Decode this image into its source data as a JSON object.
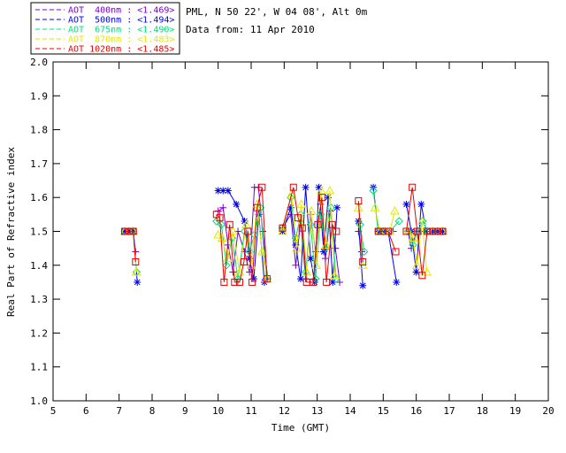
{
  "header": {
    "location_line": "PML, N 50 22', W 04 08', Alt 0m",
    "date_line": "Data from: 11 Apr 2010"
  },
  "chart_data": {
    "type": "line",
    "title": "",
    "xlabel": "Time (GMT)",
    "ylabel": "Real Part of Refractive index",
    "xlim": [
      5,
      20
    ],
    "ylim": [
      1.0,
      2.0
    ],
    "xticks": [
      "5",
      "6",
      "7",
      "8",
      "9",
      "10",
      "11",
      "12",
      "13",
      "14",
      "15",
      "16",
      "17",
      "18",
      "19",
      "20"
    ],
    "yticks": [
      "1.0",
      "1.1",
      "1.2",
      "1.3",
      "1.4",
      "1.5",
      "1.6",
      "1.7",
      "1.8",
      "1.9",
      "2.0"
    ],
    "grid": false,
    "legend_position": "top-left",
    "frame_color": "#000000",
    "series": [
      {
        "name": "AOT  400nm",
        "stat": "<1.469>",
        "color": "#7A00D0",
        "marker": "plus",
        "line_style": "solid",
        "segments": [
          [
            [
              7.17,
              1.5
            ],
            [
              7.3,
              1.5
            ],
            [
              7.43,
              1.5
            ],
            [
              7.5,
              1.44
            ]
          ],
          [
            [
              10.0,
              1.56
            ],
            [
              10.15,
              1.57
            ],
            [
              10.3,
              1.46
            ],
            [
              10.45,
              1.38
            ],
            [
              10.6,
              1.5
            ],
            [
              10.8,
              1.44
            ],
            [
              10.95,
              1.38
            ],
            [
              11.1,
              1.63
            ],
            [
              11.22,
              1.63
            ],
            [
              11.35,
              1.5
            ],
            [
              11.5,
              1.36
            ]
          ],
          [
            [
              11.95,
              1.51
            ],
            [
              12.2,
              1.55
            ],
            [
              12.35,
              1.4
            ],
            [
              12.5,
              1.53
            ],
            [
              12.65,
              1.36
            ],
            [
              12.8,
              1.55
            ],
            [
              12.95,
              1.44
            ],
            [
              13.1,
              1.58
            ],
            [
              13.25,
              1.42
            ],
            [
              13.4,
              1.56
            ],
            [
              13.55,
              1.45
            ],
            [
              13.68,
              1.35
            ]
          ],
          [
            [
              14.25,
              1.5
            ],
            [
              14.35,
              1.44
            ]
          ],
          [
            [
              14.85,
              1.5
            ],
            [
              15.0,
              1.5
            ],
            [
              15.15,
              1.5
            ],
            [
              15.3,
              1.5
            ]
          ],
          [
            [
              15.75,
              1.5
            ],
            [
              15.85,
              1.45
            ],
            [
              16.0,
              1.5
            ],
            [
              16.15,
              1.5
            ],
            [
              16.3,
              1.5
            ]
          ],
          [
            [
              16.5,
              1.5
            ],
            [
              16.65,
              1.5
            ],
            [
              16.8,
              1.5
            ]
          ]
        ]
      },
      {
        "name": "AOT  500nm",
        "stat": "<1.494>",
        "color": "#0000F0",
        "marker": "asterisk",
        "line_style": "solid",
        "segments": [
          [
            [
              7.17,
              1.5
            ],
            [
              7.3,
              1.5
            ],
            [
              7.43,
              1.5
            ],
            [
              7.55,
              1.35
            ]
          ],
          [
            [
              10.0,
              1.62
            ],
            [
              10.15,
              1.62
            ],
            [
              10.3,
              1.62
            ],
            [
              10.55,
              1.58
            ],
            [
              10.8,
              1.53
            ],
            [
              10.95,
              1.42
            ],
            [
              11.08,
              1.36
            ],
            [
              11.23,
              1.55
            ],
            [
              11.4,
              1.35
            ]
          ],
          [
            [
              11.95,
              1.5
            ],
            [
              12.2,
              1.57
            ],
            [
              12.35,
              1.46
            ],
            [
              12.5,
              1.36
            ],
            [
              12.65,
              1.63
            ],
            [
              12.8,
              1.42
            ],
            [
              12.92,
              1.35
            ],
            [
              13.05,
              1.63
            ],
            [
              13.2,
              1.44
            ],
            [
              13.33,
              1.6
            ],
            [
              13.47,
              1.35
            ],
            [
              13.6,
              1.57
            ]
          ],
          [
            [
              14.25,
              1.53
            ],
            [
              14.38,
              1.34
            ]
          ],
          [
            [
              14.7,
              1.63
            ],
            [
              14.85,
              1.5
            ],
            [
              15.0,
              1.5
            ],
            [
              15.15,
              1.5
            ],
            [
              15.4,
              1.35
            ]
          ],
          [
            [
              15.7,
              1.58
            ],
            [
              15.85,
              1.5
            ],
            [
              16.0,
              1.38
            ],
            [
              16.15,
              1.58
            ],
            [
              16.3,
              1.5
            ]
          ],
          [
            [
              16.5,
              1.5
            ],
            [
              16.65,
              1.5
            ],
            [
              16.8,
              1.5
            ]
          ]
        ]
      },
      {
        "name": "AOT  675nm",
        "stat": "<1.490>",
        "color": "#00E07A",
        "marker": "diamond",
        "line_style": "solid",
        "segments": [
          [
            [
              7.17,
              1.5
            ],
            [
              7.3,
              1.5
            ],
            [
              7.43,
              1.5
            ],
            [
              7.53,
              1.38
            ]
          ],
          [
            [
              9.95,
              1.53
            ],
            [
              10.1,
              1.52
            ],
            [
              10.25,
              1.4
            ],
            [
              10.42,
              1.48
            ],
            [
              10.6,
              1.36
            ],
            [
              10.8,
              1.5
            ],
            [
              10.95,
              1.44
            ],
            [
              11.1,
              1.49
            ],
            [
              11.28,
              1.57
            ],
            [
              11.45,
              1.36
            ]
          ],
          [
            [
              11.95,
              1.51
            ],
            [
              12.2,
              1.6
            ],
            [
              12.35,
              1.48
            ],
            [
              12.5,
              1.55
            ],
            [
              12.65,
              1.38
            ],
            [
              12.8,
              1.52
            ],
            [
              12.95,
              1.36
            ],
            [
              13.1,
              1.55
            ],
            [
              13.25,
              1.45
            ],
            [
              13.42,
              1.57
            ],
            [
              13.57,
              1.36
            ]
          ],
          [
            [
              14.3,
              1.52
            ],
            [
              14.42,
              1.44
            ]
          ],
          [
            [
              14.7,
              1.62
            ],
            [
              14.85,
              1.5
            ],
            [
              15.0,
              1.5
            ],
            [
              15.2,
              1.5
            ],
            [
              15.48,
              1.53
            ]
          ],
          [
            [
              15.75,
              1.5
            ],
            [
              15.9,
              1.46
            ],
            [
              16.05,
              1.5
            ],
            [
              16.2,
              1.53
            ],
            [
              16.35,
              1.5
            ]
          ],
          [
            [
              16.5,
              1.5
            ],
            [
              16.65,
              1.5
            ],
            [
              16.8,
              1.5
            ]
          ]
        ]
      },
      {
        "name": "AOT  870nm",
        "stat": "<1.483>",
        "color": "#E6E600",
        "marker": "triangle",
        "line_style": "solid",
        "segments": [
          [
            [
              7.17,
              1.5
            ],
            [
              7.3,
              1.5
            ],
            [
              7.43,
              1.5
            ],
            [
              7.52,
              1.38
            ]
          ],
          [
            [
              10.0,
              1.49
            ],
            [
              10.12,
              1.48
            ],
            [
              10.28,
              1.42
            ],
            [
              10.45,
              1.5
            ],
            [
              10.65,
              1.38
            ],
            [
              10.85,
              1.52
            ],
            [
              11.0,
              1.4
            ],
            [
              11.18,
              1.58
            ],
            [
              11.33,
              1.44
            ],
            [
              11.48,
              1.36
            ]
          ],
          [
            [
              11.95,
              1.5
            ],
            [
              12.22,
              1.61
            ],
            [
              12.38,
              1.45
            ],
            [
              12.52,
              1.58
            ],
            [
              12.68,
              1.38
            ],
            [
              12.82,
              1.56
            ],
            [
              12.97,
              1.4
            ],
            [
              13.12,
              1.62
            ],
            [
              13.27,
              1.46
            ],
            [
              13.38,
              1.62
            ],
            [
              13.53,
              1.37
            ]
          ],
          [
            [
              14.25,
              1.57
            ],
            [
              14.38,
              1.4
            ]
          ],
          [
            [
              14.75,
              1.57
            ],
            [
              14.9,
              1.5
            ],
            [
              15.05,
              1.5
            ],
            [
              15.2,
              1.5
            ],
            [
              15.35,
              1.56
            ]
          ],
          [
            [
              15.75,
              1.5
            ],
            [
              15.9,
              1.48
            ],
            [
              16.02,
              1.4
            ],
            [
              16.18,
              1.53
            ],
            [
              16.32,
              1.38
            ]
          ],
          [
            [
              16.5,
              1.5
            ],
            [
              16.65,
              1.5
            ],
            [
              16.8,
              1.5
            ]
          ]
        ]
      },
      {
        "name": "AOT 1020nm",
        "stat": "<1.485>",
        "color": "#E80000",
        "marker": "square",
        "line_style": "solid",
        "segments": [
          [
            [
              7.17,
              1.5
            ],
            [
              7.3,
              1.5
            ],
            [
              7.43,
              1.5
            ],
            [
              7.5,
              1.41
            ]
          ],
          [
            [
              9.95,
              1.55
            ],
            [
              10.05,
              1.54
            ],
            [
              10.18,
              1.35
            ],
            [
              10.35,
              1.52
            ],
            [
              10.5,
              1.35
            ],
            [
              10.65,
              1.35
            ],
            [
              10.78,
              1.41
            ],
            [
              10.9,
              1.5
            ],
            [
              11.03,
              1.35
            ],
            [
              11.18,
              1.57
            ],
            [
              11.33,
              1.63
            ],
            [
              11.48,
              1.36
            ]
          ],
          [
            [
              11.95,
              1.51
            ],
            [
              12.28,
              1.63
            ],
            [
              12.42,
              1.54
            ],
            [
              12.55,
              1.51
            ],
            [
              12.68,
              1.35
            ],
            [
              12.88,
              1.35
            ],
            [
              13.02,
              1.52
            ],
            [
              13.14,
              1.6
            ],
            [
              13.28,
              1.35
            ],
            [
              13.45,
              1.52
            ],
            [
              13.58,
              1.5
            ]
          ],
          [
            [
              14.25,
              1.59
            ],
            [
              14.38,
              1.41
            ]
          ],
          [
            [
              14.85,
              1.5
            ],
            [
              15.0,
              1.5
            ],
            [
              15.15,
              1.5
            ],
            [
              15.38,
              1.44
            ]
          ],
          [
            [
              15.7,
              1.5
            ],
            [
              15.88,
              1.63
            ],
            [
              16.03,
              1.5
            ],
            [
              16.18,
              1.37
            ],
            [
              16.33,
              1.5
            ]
          ],
          [
            [
              16.5,
              1.5
            ],
            [
              16.65,
              1.5
            ],
            [
              16.8,
              1.5
            ]
          ]
        ]
      }
    ]
  }
}
